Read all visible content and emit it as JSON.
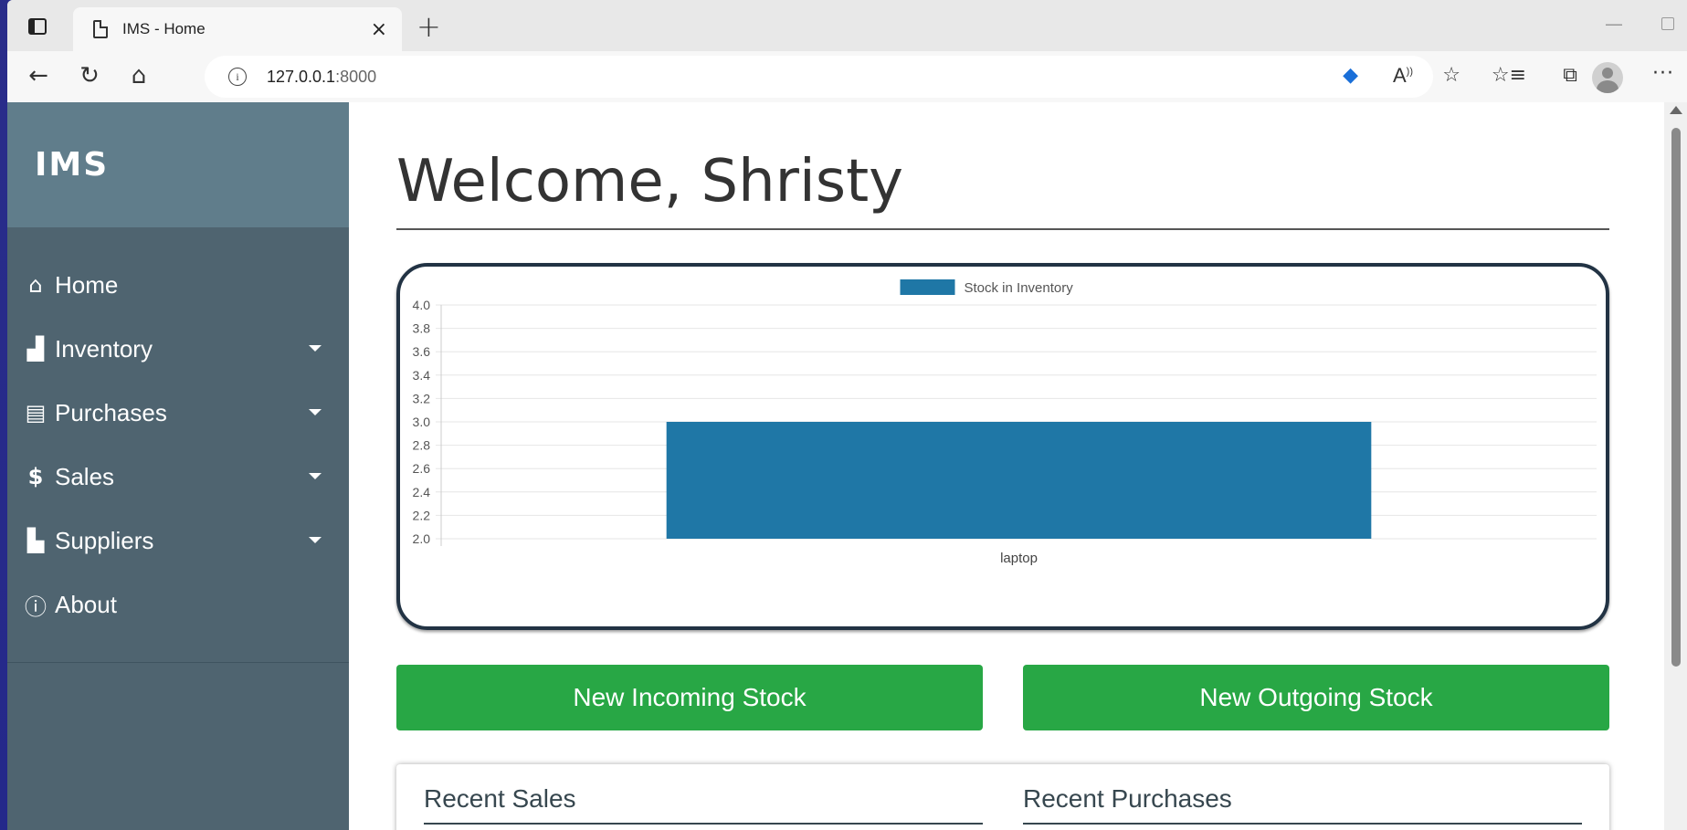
{
  "browser": {
    "tab_title": "IMS - Home",
    "url_host": "127.0.0.1",
    "url_port": ":8000",
    "new_tab": "+",
    "close_tab": "×"
  },
  "sidebar": {
    "brand": "IMS",
    "items": [
      {
        "label": "Home",
        "icon": "home-icon",
        "has_dropdown": false
      },
      {
        "label": "Inventory",
        "icon": "boxes-icon",
        "has_dropdown": true
      },
      {
        "label": "Purchases",
        "icon": "cash-register-icon",
        "has_dropdown": true
      },
      {
        "label": "Sales",
        "icon": "dollar-icon",
        "has_dropdown": true
      },
      {
        "label": "Suppliers",
        "icon": "pallet-icon",
        "has_dropdown": true
      },
      {
        "label": "About",
        "icon": "info-circle-icon",
        "has_dropdown": false
      }
    ]
  },
  "main": {
    "welcome": "Welcome, Shristy",
    "buttons": {
      "incoming": "New Incoming Stock",
      "outgoing": "New Outgoing Stock"
    },
    "recent": {
      "sales_title": "Recent Sales",
      "purchases_title": "Recent Purchases"
    }
  },
  "colors": {
    "sidebar": "#4f6470",
    "brand_bg": "#607d8b",
    "button_green": "#28a745",
    "bar": "#1f77a6"
  },
  "chart_data": {
    "type": "bar",
    "categories": [
      "laptop"
    ],
    "series": [
      {
        "name": "Stock in Inventory",
        "values": [
          3
        ]
      }
    ],
    "ylim": [
      2.0,
      4.0
    ],
    "yticks": [
      "4.0",
      "3.8",
      "3.6",
      "3.4",
      "3.2",
      "3.0",
      "2.8",
      "2.6",
      "2.4",
      "2.2",
      "2.0"
    ],
    "legend": "top-center",
    "grid": true
  }
}
